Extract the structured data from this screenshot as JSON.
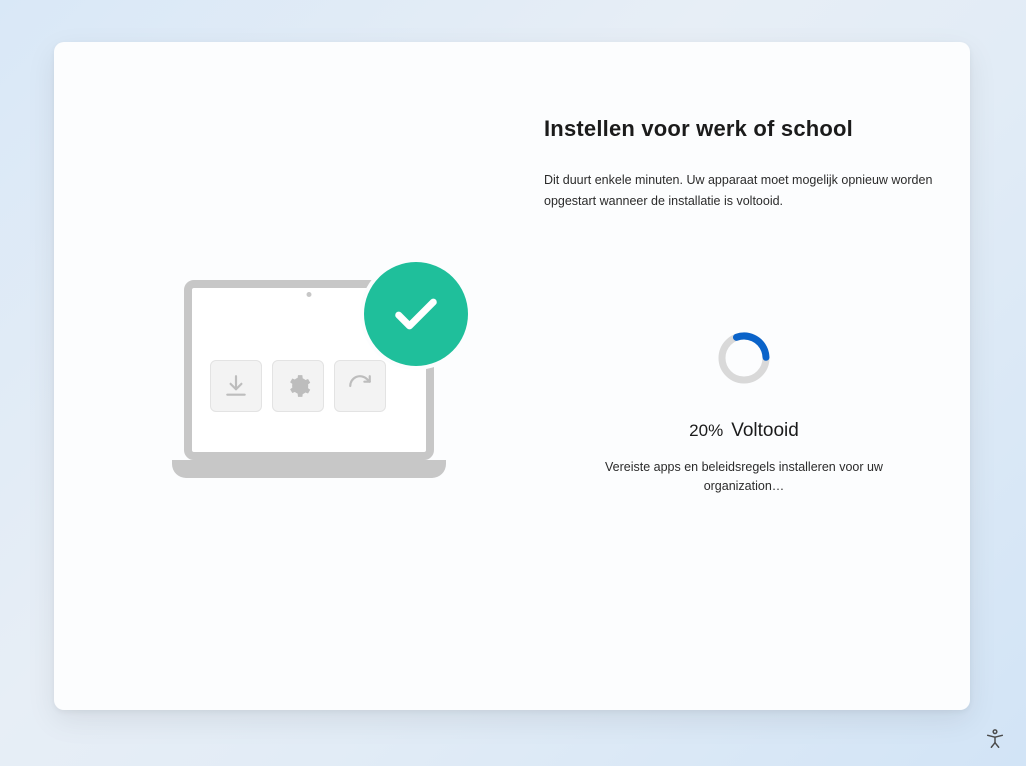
{
  "header": {
    "title": "Instellen voor werk of school",
    "subtitle": "Dit duurt enkele minuten. Uw apparaat moet mogelijk opnieuw worden opgestart wanneer de installatie is voltooid."
  },
  "progress": {
    "percent_text": "20%",
    "percent_value": 20,
    "label": "Voltooid",
    "detail": "Vereiste apps en beleidsregels installeren voor uw organization…"
  },
  "illustration": {
    "tiles": [
      "download-icon",
      "gear-icon",
      "refresh-icon"
    ],
    "badge": "checkmark-icon"
  },
  "accessibility_button": "Toegankelijkheid"
}
